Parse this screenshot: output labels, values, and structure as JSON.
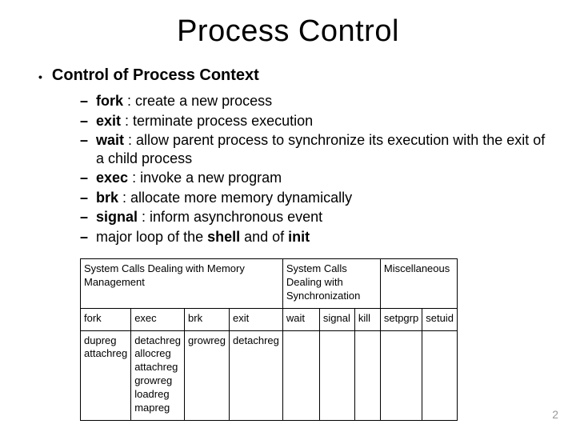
{
  "title": "Process Control",
  "section": "Control of Process Context",
  "items": [
    {
      "term": "fork",
      "desc": " : create a new process"
    },
    {
      "term": "exit",
      "desc": " : terminate process execution"
    },
    {
      "term": "wait",
      "desc": " : allow parent process to synchronize its execution with the exit of a child process"
    },
    {
      "term": "exec",
      "desc": " : invoke a new program"
    },
    {
      "term": "brk",
      "desc": " : allocate more memory dynamically"
    },
    {
      "term": "signal",
      "desc": " : inform asynchronous event"
    }
  ],
  "trailing": {
    "pre": "major loop of the ",
    "bold1": "shell",
    "mid": " and of ",
    "bold2": "init"
  },
  "table": {
    "group_headers": [
      "System Calls Dealing with Memory Management",
      "System Calls Dealing with Synchronization",
      "Miscellaneous"
    ],
    "row1": [
      "fork",
      "exec",
      "brk",
      "exit",
      "wait",
      "signal",
      "kill",
      "setpgrp",
      "setuid"
    ],
    "row2": [
      "dupreg attachreg",
      "detachreg allocreg attachreg growreg loadreg mapreg",
      "growreg",
      "detachreg",
      "",
      "",
      "",
      "",
      ""
    ]
  },
  "page": "2"
}
